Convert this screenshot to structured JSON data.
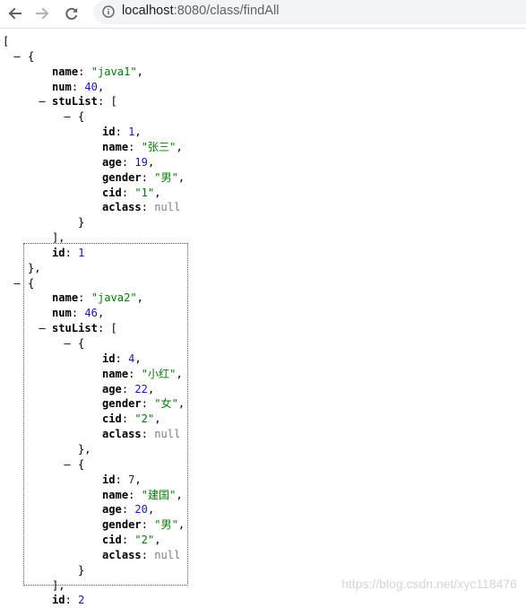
{
  "browser": {
    "url_host": "localhost",
    "url_rest": ":8080/class/findAll"
  },
  "json_lines": [
    {
      "t": "["
    },
    {
      "g": "–",
      "t": "{"
    },
    {
      "k": "name",
      "v": "\"java1\"",
      "vt": "str",
      "c": ","
    },
    {
      "k": "num",
      "v": "40",
      "vt": "num",
      "c": ","
    },
    {
      "g": "–",
      "k": "stuList",
      "t": "["
    },
    {
      "g": "–",
      "t": "{"
    },
    {
      "k": "id",
      "v": "1",
      "vt": "num",
      "c": ","
    },
    {
      "k": "name",
      "v": "\"张三\"",
      "vt": "str",
      "c": ","
    },
    {
      "k": "age",
      "v": "19",
      "vt": "num",
      "c": ","
    },
    {
      "k": "gender",
      "v": "\"男\"",
      "vt": "str",
      "c": ","
    },
    {
      "k": "cid",
      "v": "\"1\"",
      "vt": "str",
      "c": ","
    },
    {
      "k": "aclass",
      "v": "null",
      "vt": "nul",
      "c": ""
    },
    {
      "t": "}"
    },
    {
      "t": "],"
    },
    {
      "k": "id",
      "v": "1",
      "vt": "num",
      "c": ""
    },
    {
      "t": "},"
    },
    {
      "g": "–",
      "t": "{"
    },
    {
      "k": "name",
      "v": "\"java2\"",
      "vt": "str",
      "c": ","
    },
    {
      "k": "num",
      "v": "46",
      "vt": "num",
      "c": ","
    },
    {
      "g": "–",
      "k": "stuList",
      "t": "["
    },
    {
      "g": "–",
      "t": "{"
    },
    {
      "k": "id",
      "v": "4",
      "vt": "num",
      "c": ","
    },
    {
      "k": "name",
      "v": "\"小红\"",
      "vt": "str",
      "c": ","
    },
    {
      "k": "age",
      "v": "22",
      "vt": "num",
      "c": ","
    },
    {
      "k": "gender",
      "v": "\"女\"",
      "vt": "str",
      "c": ","
    },
    {
      "k": "cid",
      "v": "\"2\"",
      "vt": "str",
      "c": ","
    },
    {
      "k": "aclass",
      "v": "null",
      "vt": "nul",
      "c": ""
    },
    {
      "t": "},"
    },
    {
      "g": "–",
      "t": "{"
    },
    {
      "k": "id",
      "v": "7",
      "vt": "num",
      "c": ","
    },
    {
      "k": "name",
      "v": "\"建国\"",
      "vt": "str",
      "c": ","
    },
    {
      "k": "age",
      "v": "20",
      "vt": "num",
      "c": ","
    },
    {
      "k": "gender",
      "v": "\"男\"",
      "vt": "str",
      "c": ","
    },
    {
      "k": "cid",
      "v": "\"2\"",
      "vt": "str",
      "c": ","
    },
    {
      "k": "aclass",
      "v": "null",
      "vt": "nul",
      "c": ""
    },
    {
      "t": "}"
    },
    {
      "t": "],"
    },
    {
      "k": "id",
      "v": "2",
      "vt": "num",
      "c": ""
    }
  ],
  "watermark": "https://blog.csdn.net/xyc118476"
}
